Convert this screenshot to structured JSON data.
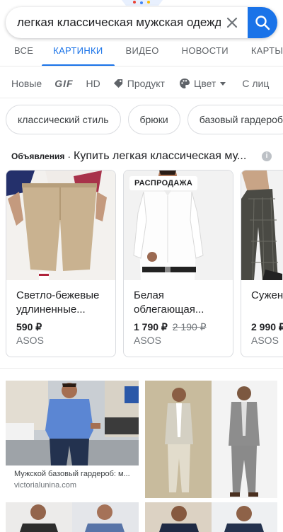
{
  "search": {
    "query": "легкая классическая мужская одежд"
  },
  "tabs": [
    {
      "label": "ВСЕ"
    },
    {
      "label": "КАРТИНКИ"
    },
    {
      "label": "ВИДЕО"
    },
    {
      "label": "НОВОСТИ"
    },
    {
      "label": "КАРТЫ"
    }
  ],
  "filters": [
    {
      "label": "Новые"
    },
    {
      "label": "GIF"
    },
    {
      "label": "HD"
    },
    {
      "label": "Продукт",
      "icon": "tag-icon"
    },
    {
      "label": "Цвет",
      "icon": "palette-icon"
    },
    {
      "label": "С лиц"
    }
  ],
  "chips": [
    {
      "label": "классический стиль"
    },
    {
      "label": "брюки"
    },
    {
      "label": "базовый гардероб"
    }
  ],
  "ads": {
    "label": "Объявления",
    "separator": "·",
    "title": "Купить легкая классическая му..."
  },
  "products": [
    {
      "title": "Светло-бежевые удлиненные...",
      "price": "590 ₽",
      "old_price": "",
      "store": "ASOS",
      "badge": ""
    },
    {
      "title": "Белая облегающая...",
      "price": "1 790 ₽",
      "old_price": "2 190 ₽",
      "store": "ASOS",
      "badge": "РАСПРОДАЖА"
    },
    {
      "title": "Сужен строги",
      "price": "2 990 ₽",
      "old_price": "",
      "store": "ASOS",
      "badge": ""
    }
  ],
  "results": [
    {
      "caption": "Мужской базовый гардероб: м...",
      "source": "victorialunina.com"
    }
  ],
  "colors": {
    "accent": "#1a73e8",
    "text": "#202124",
    "muted": "#5f6368"
  }
}
